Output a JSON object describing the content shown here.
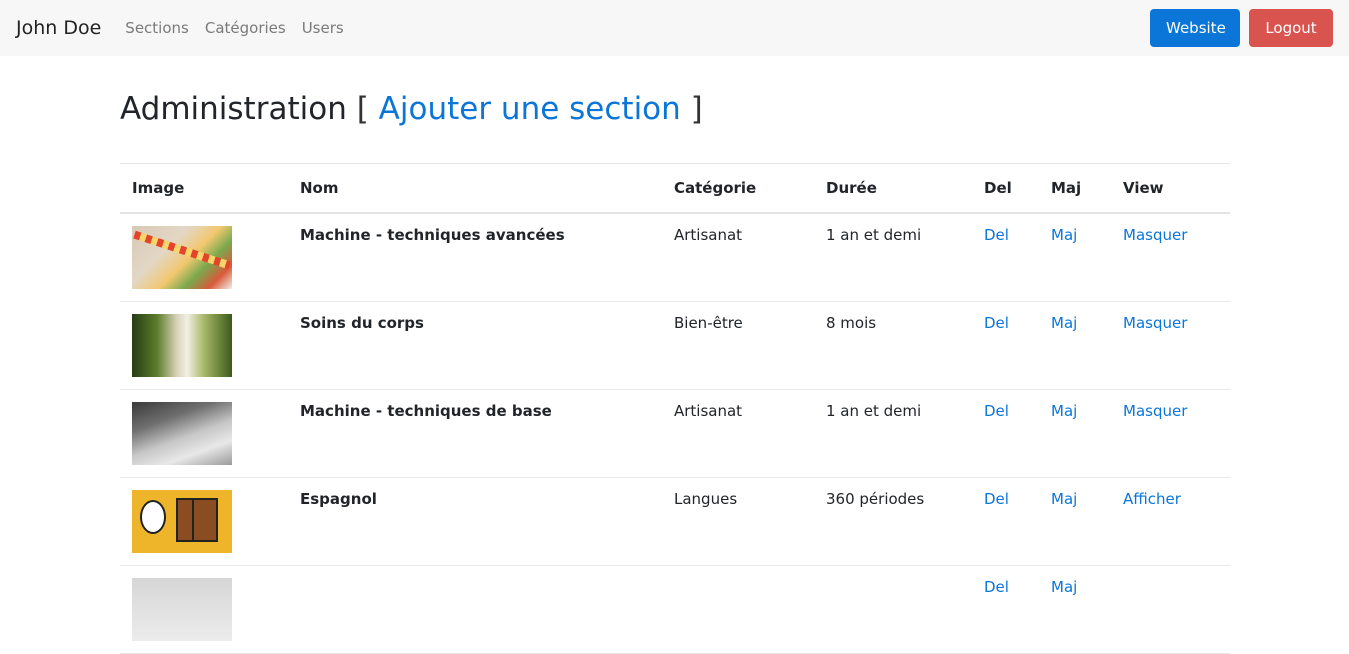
{
  "navbar": {
    "brand": "John Doe",
    "links": [
      "Sections",
      "Catégories",
      "Users"
    ],
    "website_label": "Website",
    "logout_label": "Logout"
  },
  "page": {
    "title": "Administration",
    "bracket_open": "[",
    "add_link": "Ajouter une section",
    "bracket_close": "]"
  },
  "table": {
    "headers": [
      "Image",
      "Nom",
      "Catégorie",
      "Durée",
      "Del",
      "Maj",
      "View"
    ],
    "rows": [
      {
        "image": "sewing-advanced-photo",
        "nom": "Machine - techniques avancées",
        "categorie": "Artisanat",
        "duree": "1 an et demi",
        "del": "Del",
        "maj": "Maj",
        "view": "Masquer"
      },
      {
        "image": "body-care-photo",
        "nom": "Soins du corps",
        "categorie": "Bien-être",
        "duree": "8 mois",
        "del": "Del",
        "maj": "Maj",
        "view": "Masquer"
      },
      {
        "image": "sewing-basic-photo",
        "nom": "Machine - techniques de base",
        "categorie": "Artisanat",
        "duree": "1 an et demi",
        "del": "Del",
        "maj": "Maj",
        "view": "Masquer"
      },
      {
        "image": "spanish-cartoon-image",
        "nom": "Espagnol",
        "categorie": "Langues",
        "duree": "360 périodes",
        "del": "Del",
        "maj": "Maj",
        "view": "Afficher"
      },
      {
        "image": "partially-visible-photo",
        "nom": "",
        "categorie": "",
        "duree": "",
        "del": "Del",
        "maj": "Maj",
        "view": ""
      }
    ]
  },
  "colors": {
    "link": "#0b76d8",
    "primary": "#0b76d8",
    "danger": "#d9534f",
    "navbar_bg": "#f7f7f7"
  }
}
